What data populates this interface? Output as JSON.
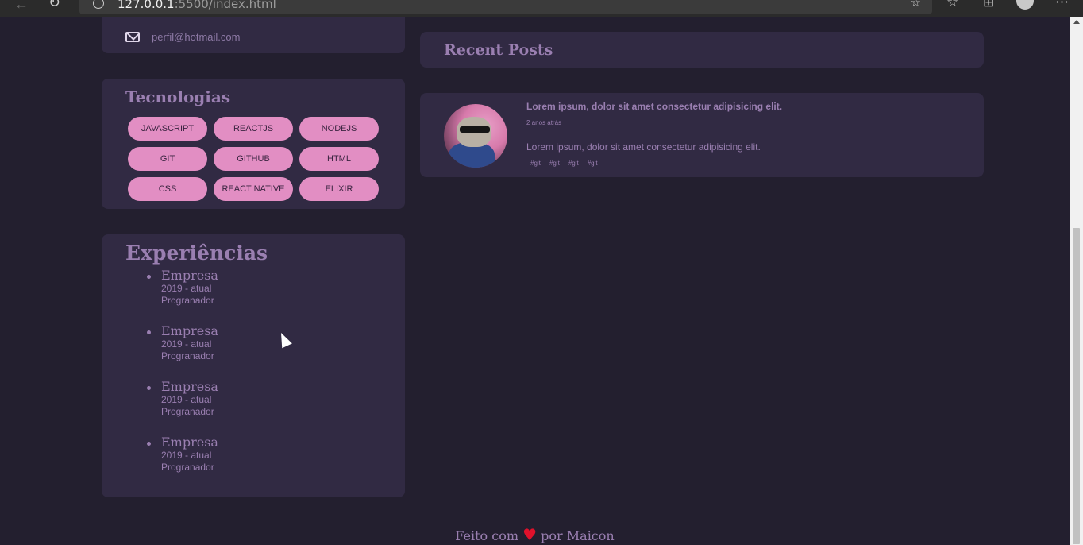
{
  "browser": {
    "url_host": "127.0.0.1",
    "url_rest": ":5500/index.html"
  },
  "contact": {
    "email": "perfil@hotmail.com"
  },
  "technologies": {
    "title": "Tecnologias",
    "items": [
      "javascript",
      "reactjs",
      "nodejs",
      "git",
      "github",
      "html",
      "css",
      "react native",
      "elixir"
    ]
  },
  "experiences": {
    "title": "Experiências",
    "items": [
      {
        "company": "Empresa",
        "period": "2019 - atual",
        "role": "Progranador"
      },
      {
        "company": "Empresa",
        "period": "2019 - atual",
        "role": "Progranador"
      },
      {
        "company": "Empresa",
        "period": "2019 - atual",
        "role": "Progranador"
      },
      {
        "company": "Empresa",
        "period": "2019 - atual",
        "role": "Progranador"
      }
    ]
  },
  "recent_posts": {
    "title": "Recent Posts",
    "posts": [
      {
        "title": "Lorem ipsum, dolor sit amet consectetur adipisicing elit.",
        "date": "2 anos atrás",
        "excerpt": "Lorem ipsum, dolor sit amet consectetur adipisicing elit.",
        "tags": [
          "#git",
          "#git",
          "#git",
          "#git"
        ]
      }
    ]
  },
  "footer": {
    "before": "Feito com",
    "heart": "♥",
    "after": "por Maicon"
  },
  "colors": {
    "background": "#231f2f",
    "card": "#312a43",
    "accent_pill": "#e28ec3",
    "text": "#9a7fb1",
    "heart": "#e0112b"
  }
}
